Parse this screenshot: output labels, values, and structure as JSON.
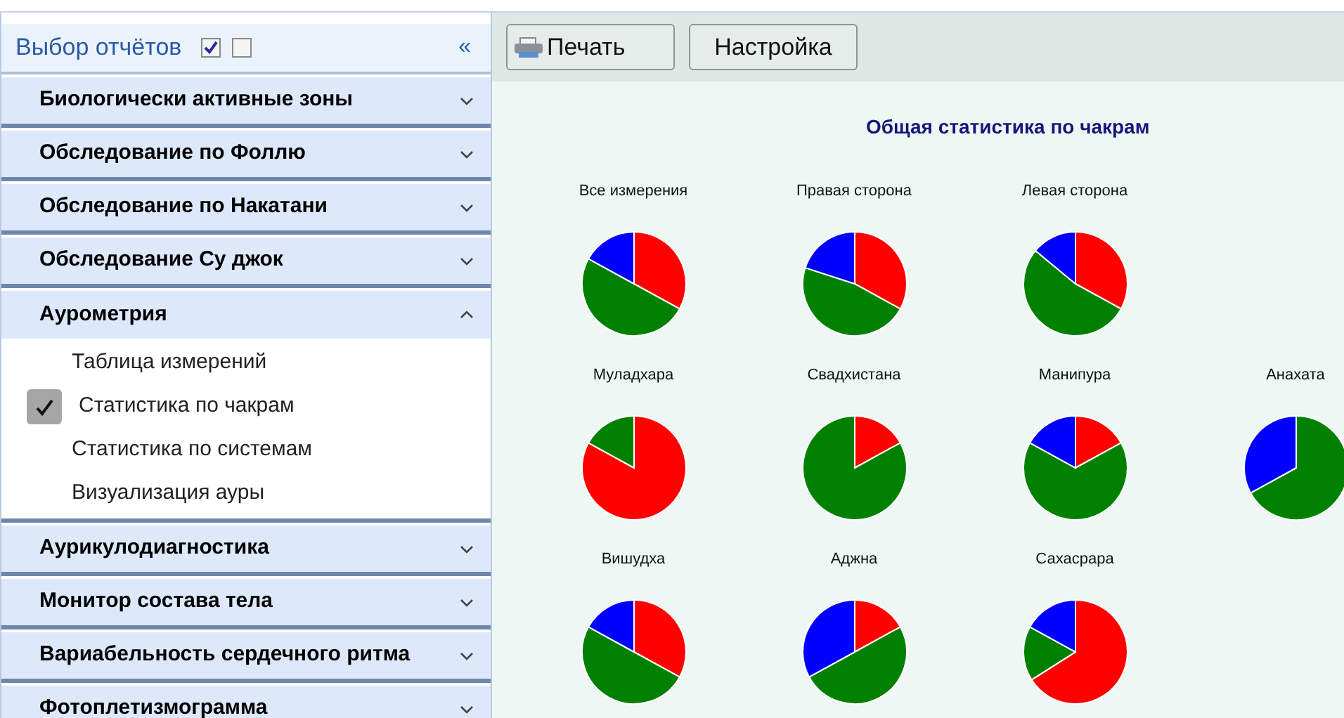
{
  "sidebar": {
    "title": "Выбор отчётов",
    "checkboxes": [
      {
        "checked": true
      },
      {
        "checked": false
      }
    ],
    "collapse_button": "«",
    "sections": [
      {
        "label": "Биологически активные зоны",
        "expanded": false
      },
      {
        "label": "Обследование по Фоллю",
        "expanded": false
      },
      {
        "label": "Обследование по Накатани",
        "expanded": false
      },
      {
        "label": "Обследование Су джок",
        "expanded": false
      },
      {
        "label": "Аурометрия",
        "expanded": true,
        "items": [
          {
            "label": "Таблица измерений",
            "selected": false
          },
          {
            "label": "Статистика по чакрам",
            "selected": true
          },
          {
            "label": "Статистика по системам",
            "selected": false
          },
          {
            "label": "Визуализация ауры",
            "selected": false
          }
        ]
      },
      {
        "label": "Аурикулодиагностика",
        "expanded": false
      },
      {
        "label": "Монитор состава тела",
        "expanded": false
      },
      {
        "label": "Вариабельность сердечного ритма",
        "expanded": false
      },
      {
        "label": "Фотоплетизмограмма",
        "expanded": false
      }
    ]
  },
  "toolbar": {
    "buttons": [
      {
        "label": "Печать",
        "kind": "print"
      },
      {
        "label": "Настройка",
        "kind": "plain"
      }
    ]
  },
  "report": {
    "title": "Общая статистика по чакрам",
    "rows": [
      [
        "Все измерения",
        "Правая сторона",
        "Левая сторона"
      ],
      [
        "Муладхара",
        "Свадхистана",
        "Манипура",
        "Анахата"
      ],
      [
        "Вишудха",
        "Аджна",
        "Сахасрара"
      ]
    ]
  }
}
